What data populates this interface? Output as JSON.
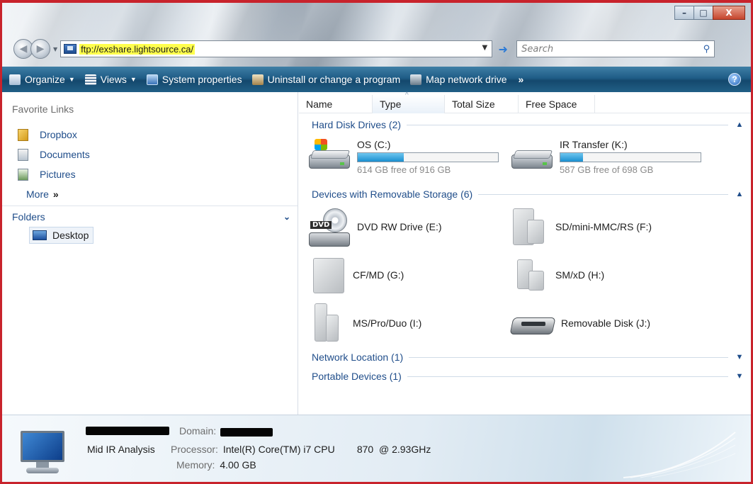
{
  "window": {
    "controls": {
      "minimize": "–",
      "maximize": "□",
      "close": "X"
    }
  },
  "address_bar": {
    "value": "ftp://exshare.lightsource.ca/",
    "search_placeholder": "Search"
  },
  "command_bar": {
    "items": [
      {
        "label": "Organize",
        "icon": "organize-icon",
        "has_dropdown": true
      },
      {
        "label": "Views",
        "icon": "views-icon",
        "has_dropdown": true
      },
      {
        "label": "System properties",
        "icon": "system-properties-icon",
        "has_dropdown": false
      },
      {
        "label": "Uninstall or change a program",
        "icon": "uninstall-icon",
        "has_dropdown": false
      },
      {
        "label": "Map network drive",
        "icon": "map-network-drive-icon",
        "has_dropdown": false
      }
    ],
    "more": "»",
    "help": "?"
  },
  "nav_pane": {
    "favorites_title": "Favorite Links",
    "favorites": [
      {
        "label": "Dropbox",
        "icon": "dropbox-folder-icon"
      },
      {
        "label": "Documents",
        "icon": "documents-icon"
      },
      {
        "label": "Pictures",
        "icon": "pictures-icon"
      }
    ],
    "more_label": "More",
    "more_glyph": "»",
    "folders_title": "Folders",
    "folders_toggle": "⌄",
    "desktop_label": "Desktop"
  },
  "columns": [
    "Name",
    "Type",
    "Total Size",
    "Free Space"
  ],
  "groups": {
    "hdd": {
      "label": "Hard Disk Drives (2)",
      "toggle": "▲"
    },
    "removable": {
      "label": "Devices with Removable Storage (6)",
      "toggle": "▲"
    },
    "network": {
      "label": "Network Location (1)",
      "toggle": "▼"
    },
    "portable": {
      "label": "Portable Devices (1)",
      "toggle": "▼"
    }
  },
  "drives": [
    {
      "name": "OS (C:)",
      "free_text": "614 GB free of 916 GB",
      "used_fraction": 0.33
    },
    {
      "name": "IR Transfer (K:)",
      "free_text": "587 GB free of 698 GB",
      "used_fraction": 0.16
    }
  ],
  "removable_devices": [
    {
      "name": "DVD RW Drive (E:)",
      "icon": "dvd-drive-icon",
      "icon_label": "DVD"
    },
    {
      "name": "SD/mini-MMC/RS (F:)",
      "icon": "sd-card-icon"
    },
    {
      "name": "CF/MD (G:)",
      "icon": "cf-card-icon"
    },
    {
      "name": "SM/xD (H:)",
      "icon": "sm-card-icon"
    },
    {
      "name": "MS/Pro/Duo (I:)",
      "icon": "ms-card-icon"
    },
    {
      "name": "Removable Disk (J:)",
      "icon": "removable-disk-icon"
    }
  ],
  "details": {
    "computer_name": "Mid IR Analysis",
    "domain_label": "Domain:",
    "processor_label": "Processor:",
    "processor_value": "Intel(R) Core(TM) i7 CPU        870  @ 2.93GHz",
    "memory_label": "Memory:",
    "memory_value": "4.00 GB"
  }
}
